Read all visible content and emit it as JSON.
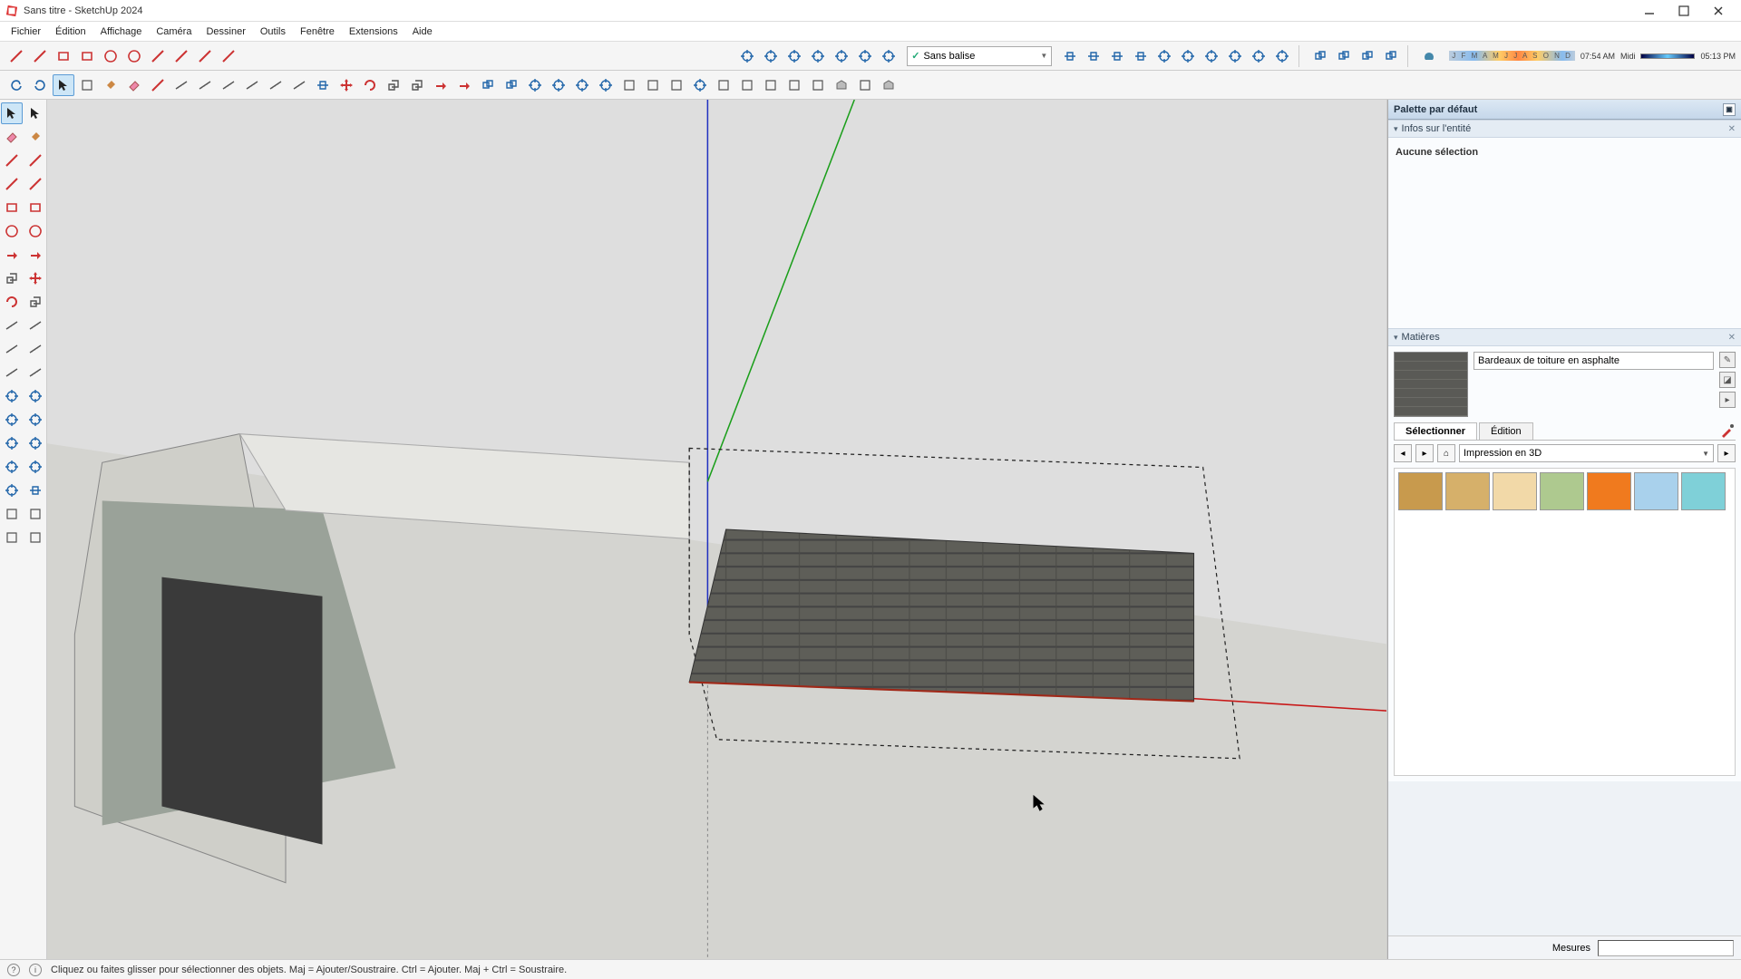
{
  "window": {
    "title": "Sans titre - SketchUp 2024"
  },
  "menu": [
    "Fichier",
    "Édition",
    "Affichage",
    "Caméra",
    "Dessiner",
    "Outils",
    "Fenêtre",
    "Extensions",
    "Aide"
  ],
  "tag_combo": {
    "label": "Sans balise"
  },
  "shadow": {
    "months": "J F M A M J J A S O N D",
    "time_left": "07:54 AM",
    "mid_label": "Midi",
    "time_right": "05:13 PM"
  },
  "tray": {
    "title": "Palette par défaut",
    "entity_panel": {
      "title": "Infos sur l'entité",
      "selection": "Aucune sélection"
    },
    "materials_panel": {
      "title": "Matières",
      "current_name": "Bardeaux de toiture en asphalte",
      "tab_select": "Sélectionner",
      "tab_edit": "Édition",
      "library": "Impression en 3D",
      "swatches": [
        "#c89a4d",
        "#d6b06a",
        "#f2d9a8",
        "#aec98f",
        "#f07a1e",
        "#a9d1ec",
        "#7fd0d8"
      ]
    }
  },
  "status": {
    "hint": "Cliquez ou faites glisser pour sélectionner des objets. Maj = Ajouter/Soustraire. Ctrl = Ajouter. Maj + Ctrl = Soustraire.",
    "measure_label": "Mesures"
  },
  "toolbar_top_left": [
    "line-tool",
    "freehand-tool",
    "rectangle-tool",
    "rotated-rect-tool",
    "circle-tool",
    "polygon-tool",
    "arc-tool",
    "two-point-arc-tool",
    "pie-tool",
    "three-point-arc-tool"
  ],
  "toolbar_top_mid": [
    "iso-view",
    "front-view",
    "house-view",
    "back-view",
    "top-view",
    "right-view",
    "left-view"
  ],
  "toolbar_top_right_a": [
    "section-plane",
    "section-display",
    "section-cut",
    "section-fill",
    "zoom-window",
    "zoom-extents",
    "previous-view",
    "next-view",
    "position-camera",
    "walk-tool"
  ],
  "toolbar_top_right_b": [
    "solid-union",
    "solid-subtract",
    "solid-trim",
    "solid-intersect"
  ],
  "toolbar_top_right_c": [
    "shadow-toggle"
  ],
  "toolbar2": [
    "undo",
    "redo",
    "select-tool-2",
    "make-component",
    "paint-bucket-2",
    "eraser-2",
    "line-2",
    "tape-measure-2",
    "dimension-tool",
    "protractor-2",
    "text-tool",
    "axes-tool",
    "3d-text",
    "section-tool",
    "move-2",
    "rotate-2",
    "scale-2",
    "offset-2",
    "pushpull-2",
    "followme-2",
    "outer-shell",
    "intersect-faces",
    "orbit-2",
    "pan-2",
    "zoom-2",
    "zoom-extents-2",
    "add-location",
    "toggle-terrain",
    "photo-match",
    "preview-match",
    "get-models",
    "share-model",
    "export-layout",
    "export-image",
    "send-to-layout",
    "extension-warehouse",
    "extension-manager",
    "3d-warehouse"
  ],
  "left_tools": [
    "select-tool",
    "lasso-tool",
    "eraser-tool",
    "paint-bucket-tool",
    "line-tool-l",
    "freehand-tool-l",
    "arc-tool-l",
    "two-point-arc-l",
    "rectangle-tool-l",
    "rotated-rect-l",
    "circle-tool-l",
    "polygon-tool-l",
    "pushpull-tool",
    "followme-tool",
    "offset-tool",
    "move-tool",
    "rotate-tool",
    "scale-tool",
    "tape-measure",
    "protractor-tool",
    "dimension-l",
    "text-label",
    "axes-l",
    "3d-text-l",
    "orbit-tool",
    "pan-tool",
    "zoom-tool",
    "zoom-window-l",
    "prev-view-l",
    "next-view-l",
    "position-camera-l",
    "look-around",
    "walk-l",
    "section-plane-l",
    "sandbox-a",
    "sandbox-b",
    "sandbox-c",
    "sandbox-d"
  ]
}
